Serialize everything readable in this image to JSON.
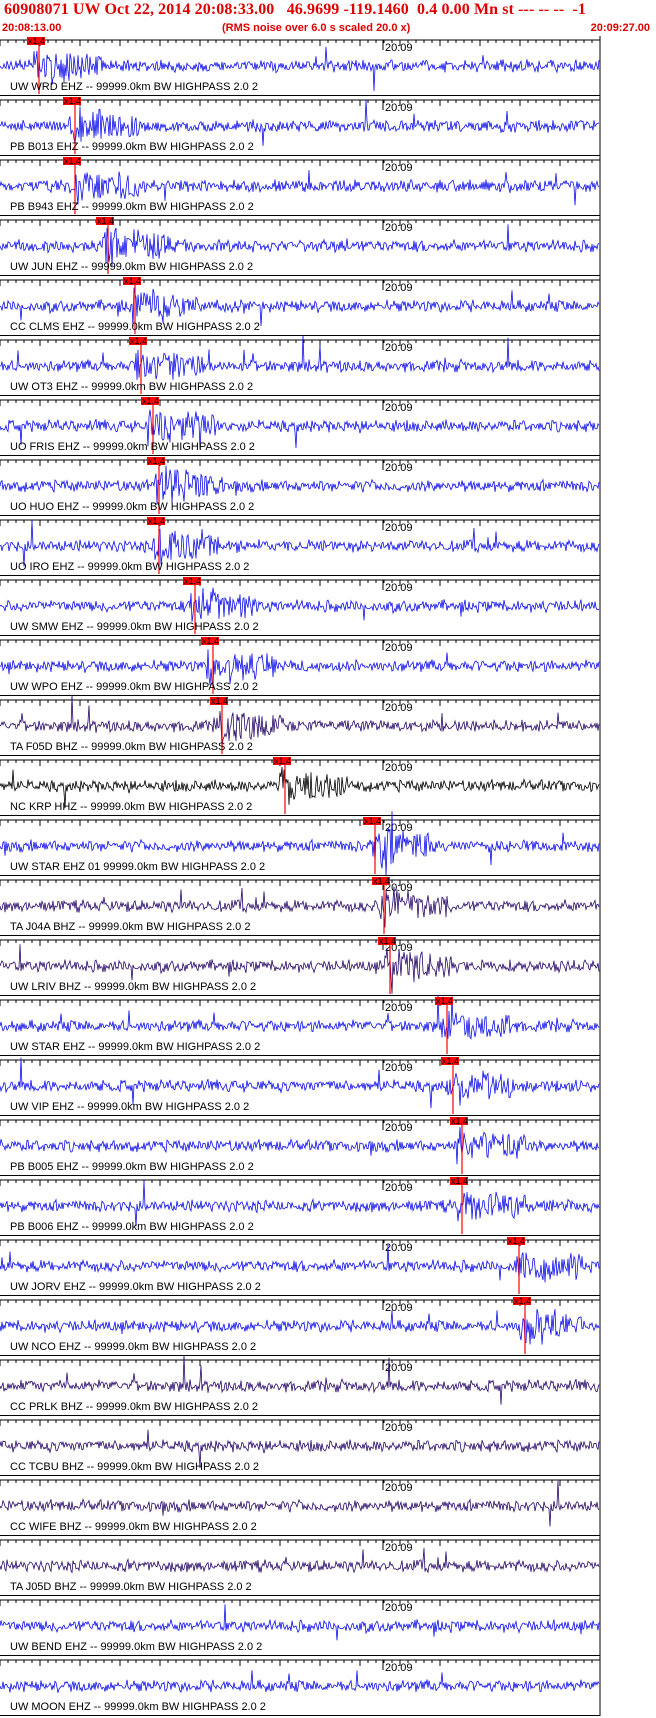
{
  "header": {
    "title": "60908071 UW Oct 22, 2014 20:08:33.00   46.9699 -119.1460  0.4 0.00 Mn st --- -- --  -1",
    "start_time": "20:08:13.00",
    "note": "(RMS noise over 6.0 s scaled 20.0 x)",
    "end_time": "20:09:27.00"
  },
  "minute_label": "20:09",
  "pick_label": "x1.4",
  "colors": {
    "header": "#e00000",
    "pick": "#ff0000",
    "axis": "#000000"
  },
  "traces": [
    {
      "label": "UW WRD EHZ -- 99999.0km BW  HIGHPASS  2.0  2",
      "color": "#1010ee",
      "pick": 0.055
    },
    {
      "label": "PB B013 EHZ -- 99999.0km BW  HIGHPASS  2.0  2",
      "color": "#1010ee",
      "pick": 0.115
    },
    {
      "label": "PB B943 EHZ -- 99999.0km BW  HIGHPASS  2.0  2",
      "color": "#1010ee",
      "pick": 0.115
    },
    {
      "label": "UW JUN EHZ -- 99999.0km BW  HIGHPASS  2.0  2",
      "color": "#1010ee",
      "pick": 0.17
    },
    {
      "label": "CC CLMS EHZ -- 99999.0km BW  HIGHPASS  2.0  2",
      "color": "#1010ee",
      "pick": 0.215
    },
    {
      "label": "UW OT3 EHZ -- 99999.0km BW  HIGHPASS  2.0  2",
      "color": "#1010ee",
      "pick": 0.225
    },
    {
      "label": "UO FRIS EHZ -- 99999.0km BW  HIGHPASS  2.0  2",
      "color": "#1010ee",
      "pick": 0.245
    },
    {
      "label": "UO HUO EHZ -- 99999.0km BW  HIGHPASS  2.0  2",
      "color": "#1010ee",
      "pick": 0.255
    },
    {
      "label": "UO IRO EHZ -- 99999.0km BW  HIGHPASS  2.0  2",
      "color": "#1010ee",
      "pick": 0.255
    },
    {
      "label": "UW SMW EHZ -- 99999.0km BW  HIGHPASS  2.0  2",
      "color": "#1010ee",
      "pick": 0.315
    },
    {
      "label": "UW WPO EHZ -- 99999.0km BW  HIGHPASS  2.0  2",
      "color": "#1010ee",
      "pick": 0.345
    },
    {
      "label": "TA F05D BHZ -- 99999.0km BW  HIGHPASS  2.0  2",
      "color": "#2a0a6a",
      "pick": 0.36
    },
    {
      "label": "NC KRP HHZ -- 99999.0km BW  HIGHPASS  2.0  2",
      "color": "#000000",
      "pick": 0.465
    },
    {
      "label": "UW STAR EHZ 01 99999.0km BW  HIGHPASS  2.0  2",
      "color": "#1010ee",
      "pick": 0.615
    },
    {
      "label": "TA J04A BHZ -- 99999.0km BW  HIGHPASS  2.0  2",
      "color": "#2a0a6a",
      "pick": 0.63
    },
    {
      "label": "UW LRIV BHZ -- 99999.0km BW  HIGHPASS  2.0  2",
      "color": "#2a0a6a",
      "pick": 0.64
    },
    {
      "label": "UW STAR EHZ -- 99999.0km BW  HIGHPASS  2.0  2",
      "color": "#1010ee",
      "pick": 0.735
    },
    {
      "label": "UW VIP EHZ -- 99999.0km BW  HIGHPASS  2.0  2",
      "color": "#1010ee",
      "pick": 0.745
    },
    {
      "label": "PB B005 EHZ -- 99999.0km BW  HIGHPASS  2.0  2",
      "color": "#1010ee",
      "pick": 0.76
    },
    {
      "label": "PB B006 EHZ -- 99999.0km BW  HIGHPASS  2.0  2",
      "color": "#1010ee",
      "pick": 0.76
    },
    {
      "label": "UW JORV EHZ -- 99999.0km BW  HIGHPASS  2.0  2",
      "color": "#1010ee",
      "pick": 0.855
    },
    {
      "label": "UW NCO EHZ -- 99999.0km BW  HIGHPASS  2.0  2",
      "color": "#1010ee",
      "pick": 0.865
    },
    {
      "label": "CC PRLK BHZ -- 99999.0km BW  HIGHPASS  2.0  2",
      "color": "#2a0a6a",
      "pick": null
    },
    {
      "label": "CC TCBU BHZ -- 99999.0km BW  HIGHPASS  2.0  2",
      "color": "#2a0a6a",
      "pick": null
    },
    {
      "label": "CC WIFE BHZ -- 99999.0km BW  HIGHPASS  2.0  2",
      "color": "#2a0a6a",
      "pick": null
    },
    {
      "label": "TA J05D BHZ -- 99999.0km BW  HIGHPASS  2.0  2",
      "color": "#2a0a6a",
      "pick": null
    },
    {
      "label": "UW BEND EHZ -- 99999.0km BW  HIGHPASS  2.0  2",
      "color": "#1010ee",
      "pick": null
    },
    {
      "label": "UW MOON EHZ -- 99999.0km BW  HIGHPASS  2.0  2",
      "color": "#1010ee",
      "pick": null
    }
  ]
}
